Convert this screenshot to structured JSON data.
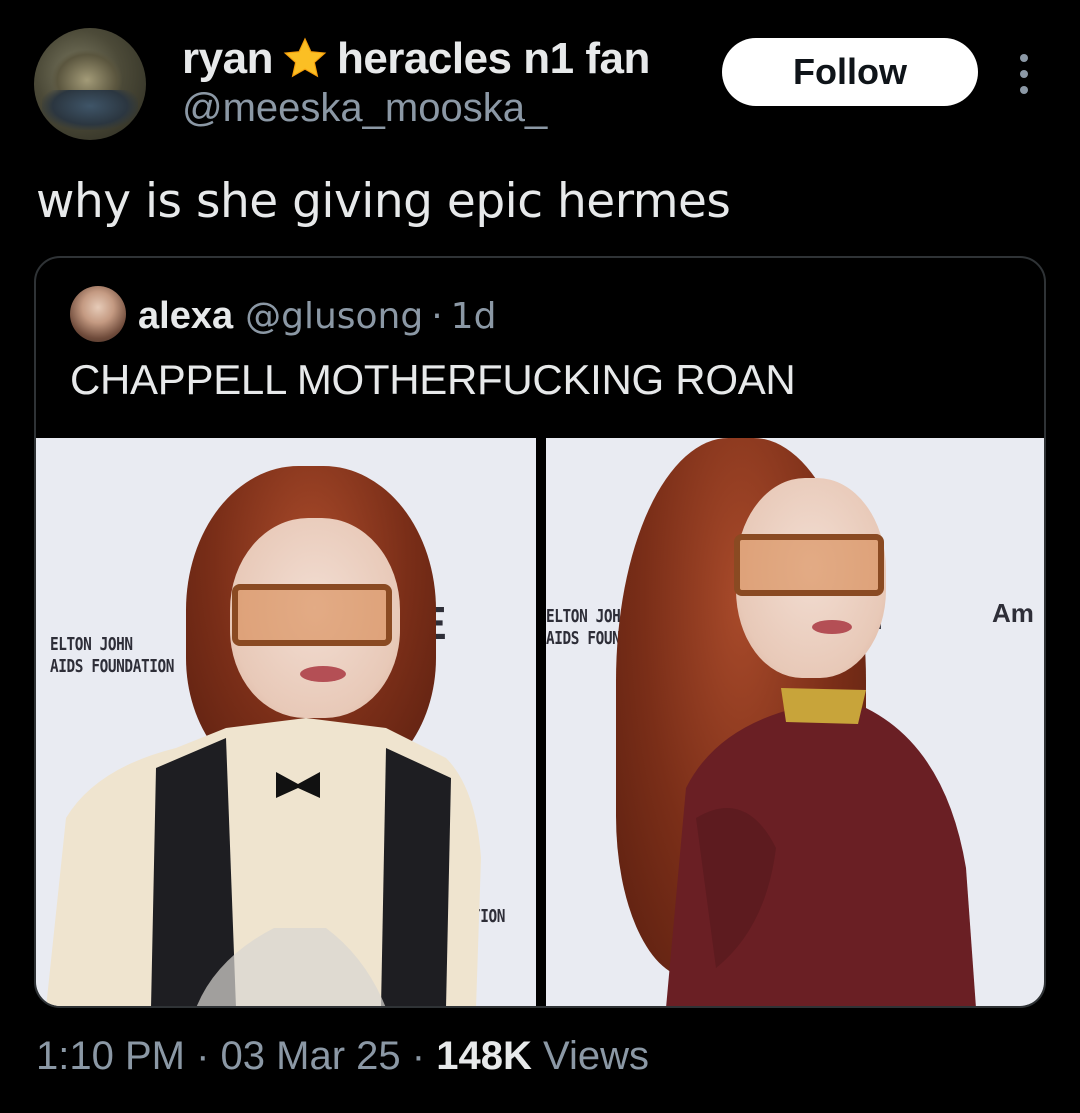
{
  "author": {
    "name_part1": "ryan",
    "name_part2": "heracles n1 fan",
    "star_icon": "star-emoji",
    "handle": "@meeska_mooska_",
    "follow_label": "Follow"
  },
  "tweet": {
    "text": "why is she giving epic hermes"
  },
  "quote": {
    "name": "alexa",
    "handle": "@glusong",
    "time": "1d",
    "separator": "·",
    "text": "CHAPPELL MOTHERFUCKING ROAN",
    "photos": [
      {
        "backdrop_line1": "ELTON JOHN",
        "backdrop_line2": "AIDS FOUNDATION",
        "backdrop_letter": "E",
        "backdrop_bottom": "TION"
      },
      {
        "backdrop_line1": "ELTON JOHN",
        "backdrop_line2": "AIDS FOUNDATI",
        "backdrop_letter": "E",
        "backdrop_right": "Am"
      }
    ]
  },
  "footer": {
    "time": "1:10 PM",
    "date": "03 Mar 25",
    "separator": "·",
    "views_count": "148K",
    "views_label": "Views"
  }
}
